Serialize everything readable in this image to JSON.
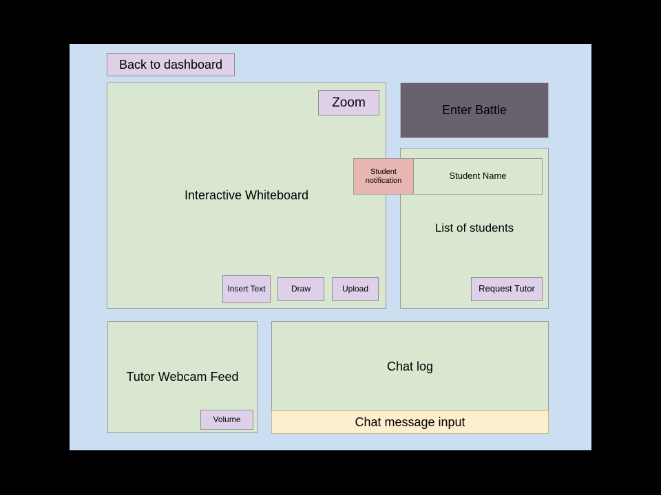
{
  "window": {
    "canvas_background": "#000000",
    "page_background": "#cbdef2"
  },
  "colors": {
    "page_bg": "#cbdef2",
    "panel_green": "#d9e7d0",
    "button_lavender": "#ded0e8",
    "button_dark": "#68626f",
    "notification_pink": "#e8b6b0",
    "chat_input_cream": "#fdeecd",
    "border_gray": "#9a9a9a"
  },
  "header": {
    "back_button_label": "Back to dashboard"
  },
  "whiteboard": {
    "title": "Interactive Whiteboard",
    "zoom_button_label": "Zoom",
    "tools": [
      {
        "label": "Insert Text",
        "name": "insert-text-button"
      },
      {
        "label": "Draw",
        "name": "draw-button"
      },
      {
        "label": "Upload",
        "name": "upload-button"
      }
    ]
  },
  "right_column": {
    "enter_battle_label": "Enter Battle",
    "student_list": {
      "title": "List of students",
      "student_name_label": "Student Name",
      "request_tutor_label": "Request Tutor"
    },
    "notification": {
      "label": "Student notification"
    }
  },
  "webcam": {
    "title": "Tutor Webcam Feed",
    "volume_button_label": "Volume"
  },
  "chat": {
    "log_title": "Chat log",
    "input_label": "Chat message input",
    "input_placeholder": "Chat message input"
  }
}
